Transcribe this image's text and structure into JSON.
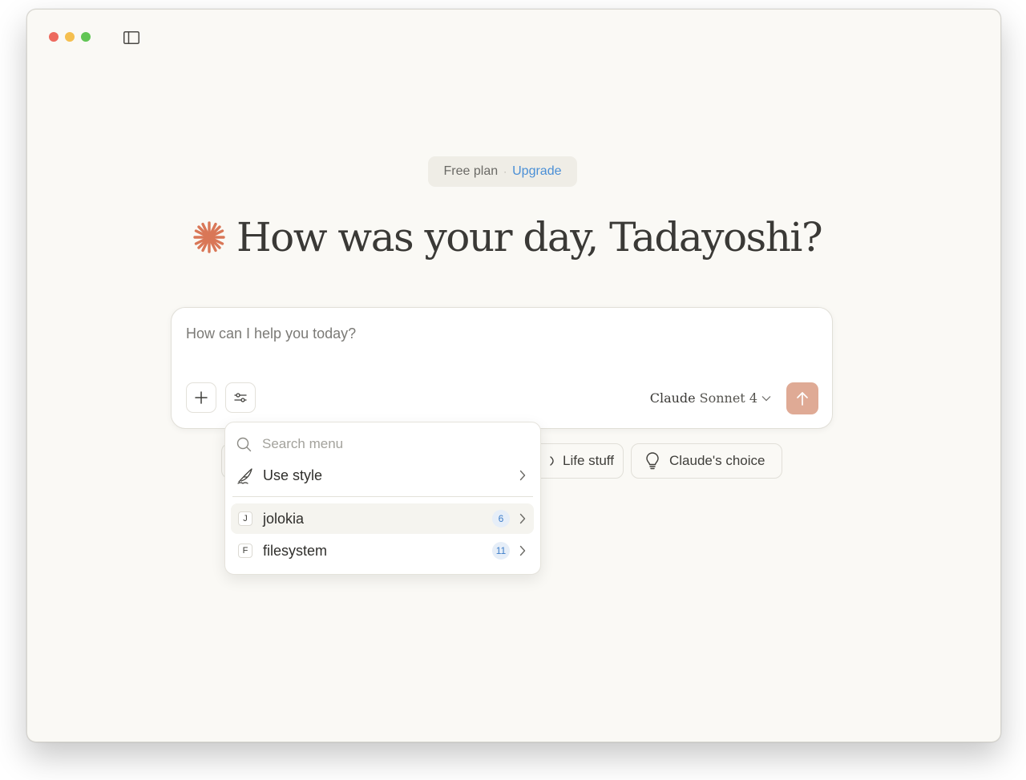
{
  "window": {
    "controls": [
      "close",
      "minimize",
      "maximize"
    ],
    "sidebar_toggle_icon": "sidebar-icon"
  },
  "plan": {
    "label": "Free plan",
    "separator": "·",
    "upgrade_label": "Upgrade"
  },
  "greeting": {
    "text": "How was your day, Tadayoshi?",
    "icon": "claude-star-icon",
    "icon_color": "#d97757"
  },
  "composer": {
    "placeholder": "How can I help you today?",
    "add_icon": "plus-icon",
    "tools_icon": "sliders-icon",
    "model": {
      "brand": "Claude",
      "name": "Sonnet 4",
      "chevron_icon": "chevron-down-icon"
    },
    "send_icon": "arrow-up-icon",
    "send_color": "#dfaa95"
  },
  "chips": [
    {
      "label": "Life stuff",
      "icon": "coffee-icon"
    },
    {
      "label": "Claude's choice",
      "icon": "lightbulb-icon"
    }
  ],
  "menu": {
    "search_placeholder": "Search menu",
    "items": [
      {
        "label": "Use style",
        "icon": "feather-icon"
      },
      {
        "label": "jolokia",
        "letter": "J",
        "count": "6",
        "highlighted": true
      },
      {
        "label": "filesystem",
        "letter": "F",
        "count": "11"
      }
    ]
  },
  "colors": {
    "background": "#faf9f5",
    "accent": "#d97757",
    "link": "#4a8fd6"
  }
}
